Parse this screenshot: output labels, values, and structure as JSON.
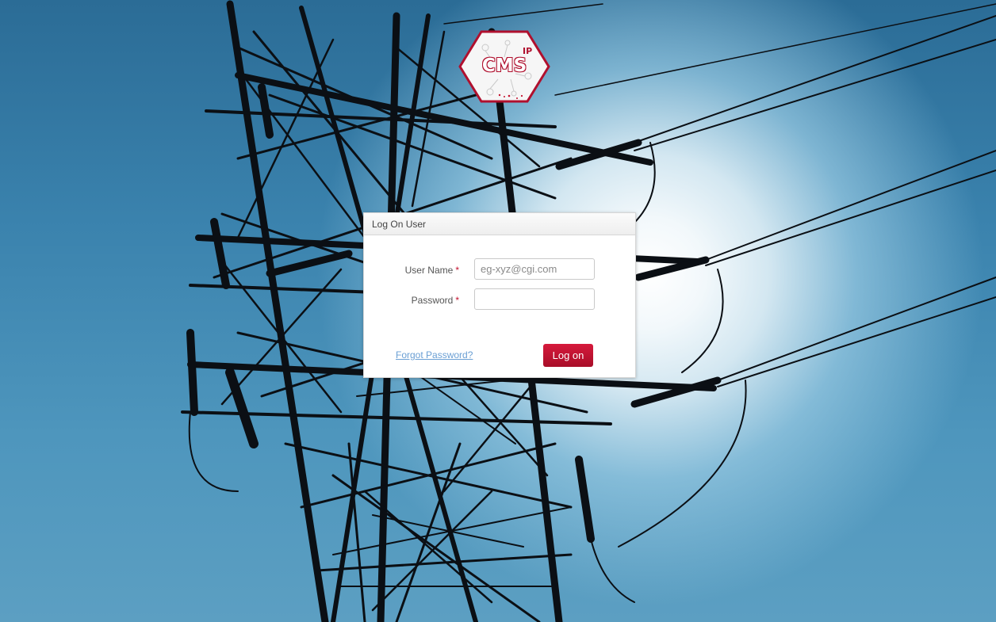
{
  "logo": {
    "brand_text": "CMS",
    "superscript": "IP",
    "icon": "cms-ip-hexagon-logo"
  },
  "dialog": {
    "title": "Log On User",
    "username_label": "User Name",
    "username_placeholder": "eg-xyz@cgi.com",
    "username_value": "",
    "password_label": "Password",
    "password_value": "",
    "required_marker": "*",
    "forgot_password_link": "Forgot Password?",
    "logon_button": "Log on"
  },
  "colors": {
    "accent": "#c4122f",
    "link": "#6a9fd4",
    "sky": "#3a82ad"
  },
  "background": {
    "icon": "power-transmission-tower-photo"
  }
}
